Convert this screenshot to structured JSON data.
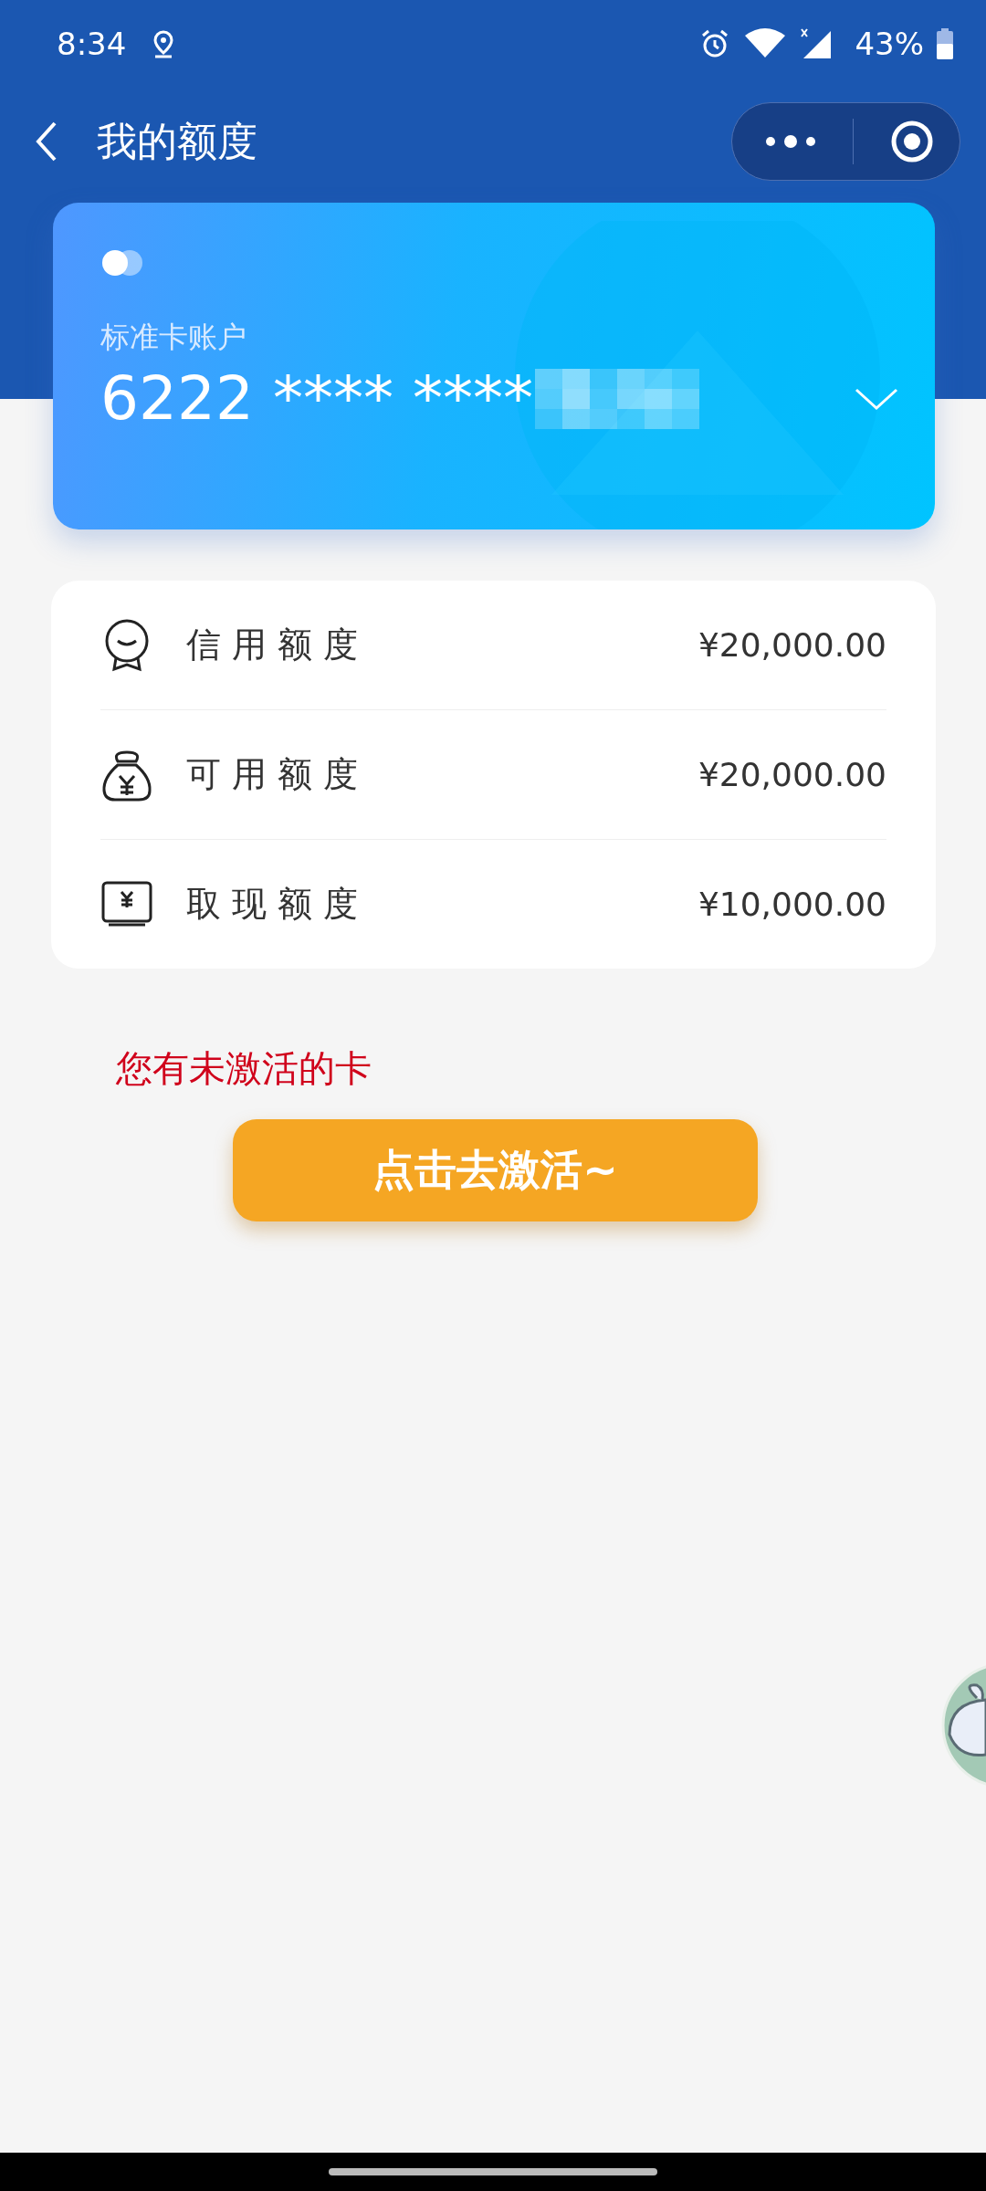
{
  "status_bar": {
    "time": "8:34",
    "battery": "43%"
  },
  "nav": {
    "title": "我的额度"
  },
  "card": {
    "label": "标准卡账户",
    "number": "6222 **** ****"
  },
  "limits": [
    {
      "kind": "credit",
      "label": "信 用 额 度",
      "amount": "¥20,000.00"
    },
    {
      "kind": "available",
      "label": "可 用 额 度",
      "amount": "¥20,000.00"
    },
    {
      "kind": "cash",
      "label": "取 现 额 度",
      "amount": "¥10,000.00"
    }
  ],
  "notice": "您有未激活的卡",
  "activate_button": "点击去激活~"
}
